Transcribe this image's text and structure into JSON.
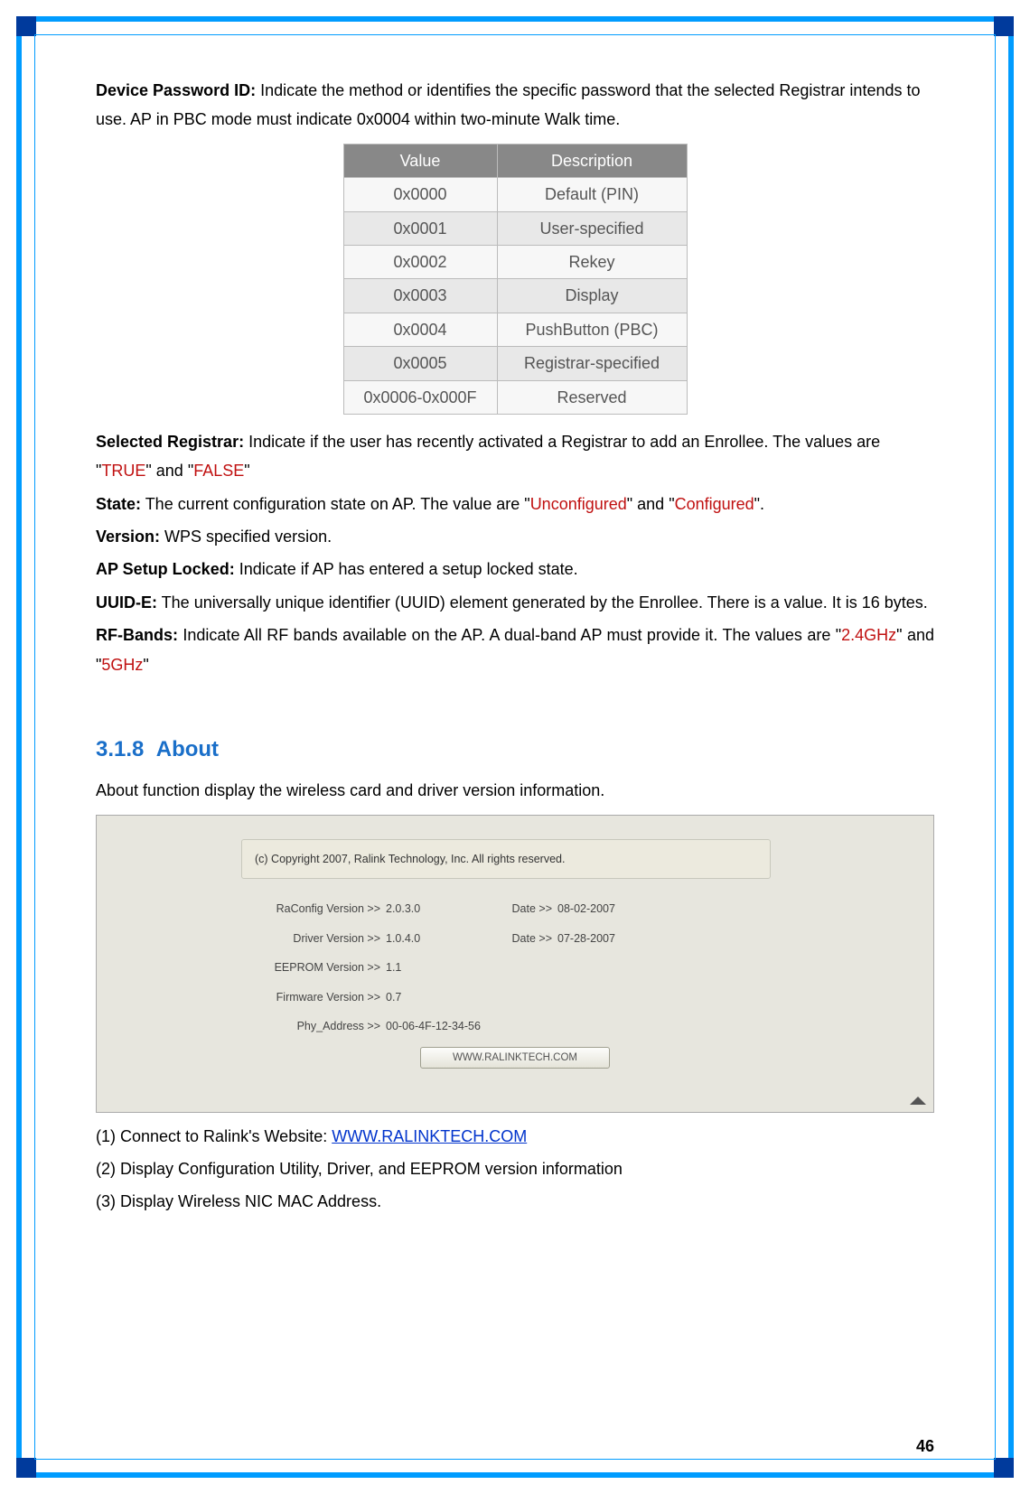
{
  "p1": {
    "label": "Device Password ID:",
    "text": " Indicate the method or identifies the specific password that the selected Registrar intends to use. AP in PBC mode must indicate 0x0004 within two-minute Walk time."
  },
  "table": {
    "head": {
      "col1": "Value",
      "col2": "Description"
    },
    "rows": [
      {
        "v": "0x0000",
        "d": "Default (PIN)"
      },
      {
        "v": "0x0001",
        "d": "User-specified"
      },
      {
        "v": "0x0002",
        "d": "Rekey"
      },
      {
        "v": "0x0003",
        "d": "Display"
      },
      {
        "v": "0x0004",
        "d": "PushButton (PBC)"
      },
      {
        "v": "0x0005",
        "d": "Registrar-specified"
      },
      {
        "v": "0x0006-0x000F",
        "d": "Reserved"
      }
    ]
  },
  "p2": {
    "label": "Selected Registrar:",
    "t1": " Indicate if the user has recently activated a Registrar to add an Enrollee. The values are \"",
    "r1": "TRUE",
    "t2": "\" and \"",
    "r2": "FALSE",
    "t3": "\""
  },
  "p3": {
    "label": "State:",
    "t1": " The current configuration state on AP. The value are \"",
    "r1": "Unconfigured",
    "t2": "\" and \"",
    "r2": "Configured",
    "t3": "\"."
  },
  "p4": {
    "label": "Version:",
    "text": " WPS specified version."
  },
  "p5": {
    "label": "AP Setup Locked:",
    "text": " Indicate if AP has entered a setup locked state."
  },
  "p6": {
    "label": "UUID-E:",
    "text": " The universally unique identifier (UUID) element generated by the Enrollee. There is a value. It is 16 bytes."
  },
  "p7": {
    "label": "RF-Bands:",
    "t1": " Indicate All RF bands available on the AP. A dual-band AP must provide it. The values are \"",
    "r1": "2.4GHz",
    "t2": "\" and \"",
    "r2": "5GHz",
    "t3": "\""
  },
  "section": {
    "num": "3.1.8",
    "title": "About",
    "intro": "About function display the wireless card and driver version information."
  },
  "about": {
    "copyright": "(c) Copyright 2007, Ralink Technology, Inc. All rights reserved.",
    "rows": {
      "r1": {
        "l": "RaConfig Version >>",
        "v": "2.0.3.0",
        "dl": "Date >>",
        "dv": "08-02-2007"
      },
      "r2": {
        "l": "Driver Version >>",
        "v": "1.0.4.0",
        "dl": "Date >>",
        "dv": "07-28-2007"
      },
      "r3": {
        "l": "EEPROM Version >>",
        "v": "1.1"
      },
      "r4": {
        "l": "Firmware Version >>",
        "v": "0.7"
      },
      "r5": {
        "l": "Phy_Address >>",
        "v": "00-06-4F-12-34-56"
      }
    },
    "button": "WWW.RALINKTECH.COM"
  },
  "list": {
    "i1a": "(1)  Connect to Ralink's Website: ",
    "i1link": "WWW.RALINKTECH.COM",
    "i2": "(2)  Display Configuration Utility, Driver, and EEPROM version information",
    "i3": "(3)  Display Wireless NIC MAC Address."
  },
  "page_num": "46"
}
